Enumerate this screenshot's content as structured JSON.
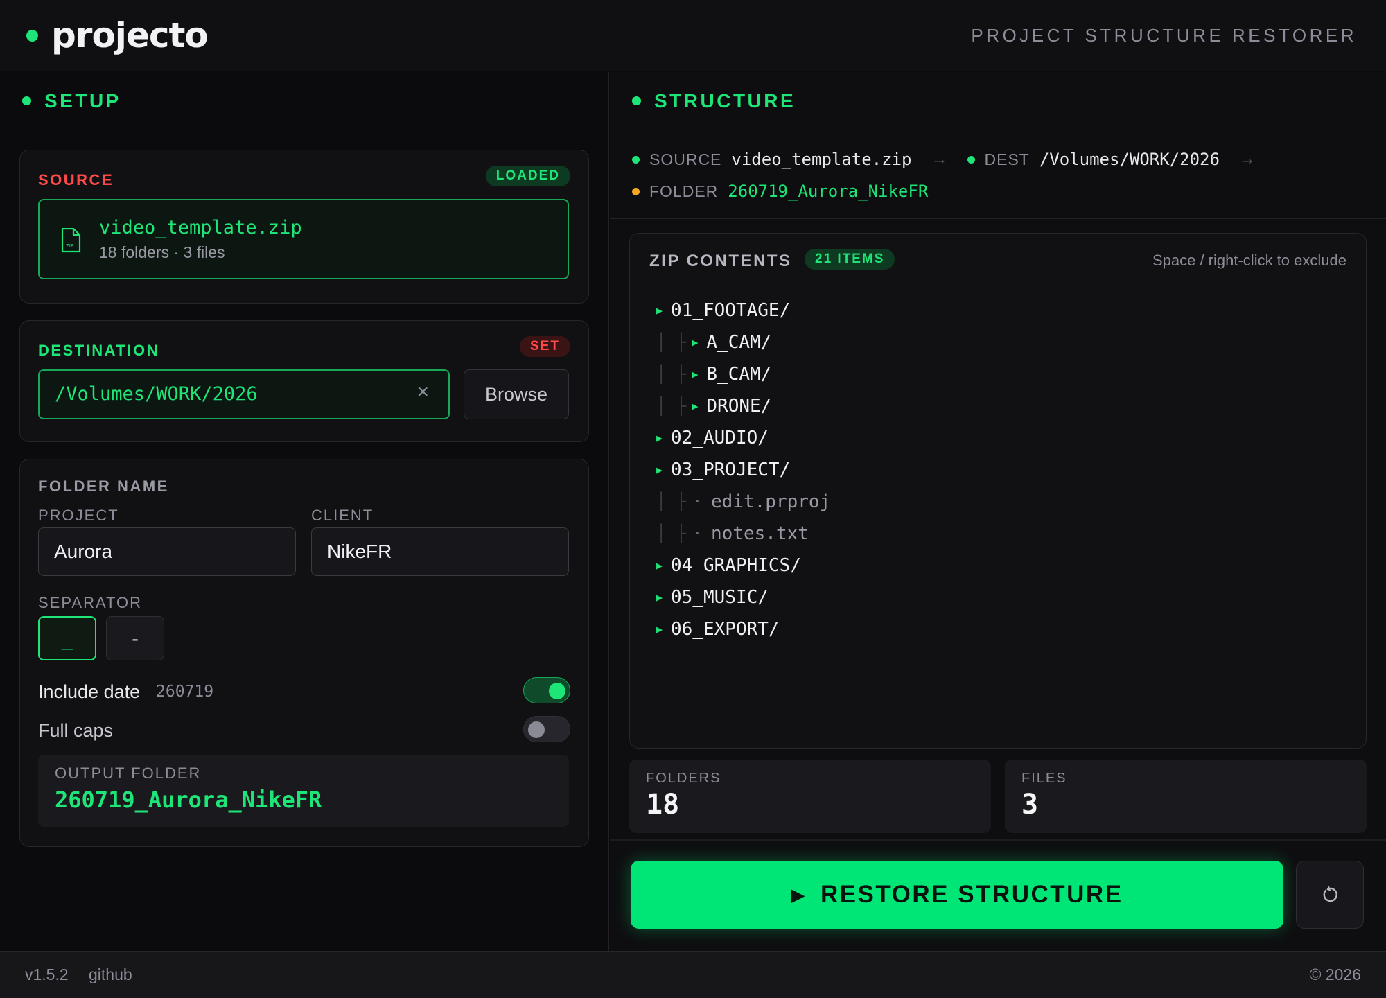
{
  "header": {
    "app_name": "projecto",
    "subtitle": "PROJECT STRUCTURE RESTORER"
  },
  "setup": {
    "title": "SETUP",
    "source": {
      "label": "SOURCE",
      "badge": "LOADED",
      "file_name": "video_template.zip",
      "meta": "18 folders · 3 files",
      "icon": "zip-file-icon"
    },
    "destination": {
      "label": "DESTINATION",
      "badge": "SET",
      "path": "/Volumes/WORK/2026",
      "clear_glyph": "×",
      "browse_label": "Browse"
    },
    "folder_name": {
      "label": "FOLDER NAME",
      "project_label": "PROJECT",
      "project_value": "Aurora",
      "client_label": "CLIENT",
      "client_value": "NikeFR",
      "separator_label": "SEPARATOR",
      "separators": [
        "_",
        "-"
      ],
      "selected_separator": "_",
      "include_date_label": "Include date",
      "include_date_value": "260719",
      "include_date_on": true,
      "full_caps_label": "Full caps",
      "full_caps_on": false,
      "output_label": "OUTPUT FOLDER",
      "output_value": "260719_Aurora_NikeFR"
    }
  },
  "structure": {
    "title": "STRUCTURE",
    "crumbs": {
      "source_key": "SOURCE",
      "source_val": "video_template.zip",
      "dest_key": "DEST",
      "dest_val": "/Volumes/WORK/2026",
      "arrow": "→",
      "folder_key": "FOLDER",
      "folder_val": "260719_Aurora_NikeFR"
    },
    "zip": {
      "title": "ZIP CONTENTS",
      "badge": "21 ITEMS",
      "hint": "Space / right-click to exclude",
      "tree": [
        {
          "name": "01_FOOTAGE/",
          "depth": 0,
          "type": "folder"
        },
        {
          "name": "A_CAM/",
          "depth": 1,
          "type": "folder"
        },
        {
          "name": "B_CAM/",
          "depth": 1,
          "type": "folder"
        },
        {
          "name": "DRONE/",
          "depth": 1,
          "type": "folder"
        },
        {
          "name": "02_AUDIO/",
          "depth": 0,
          "type": "folder"
        },
        {
          "name": "03_PROJECT/",
          "depth": 0,
          "type": "folder"
        },
        {
          "name": "edit.prproj",
          "depth": 1,
          "type": "file"
        },
        {
          "name": "notes.txt",
          "depth": 1,
          "type": "file"
        },
        {
          "name": "04_GRAPHICS/",
          "depth": 0,
          "type": "folder"
        },
        {
          "name": "05_MUSIC/",
          "depth": 0,
          "type": "folder"
        },
        {
          "name": "06_EXPORT/",
          "depth": 0,
          "type": "folder"
        }
      ]
    },
    "stats": {
      "folders_label": "FOLDERS",
      "folders_value": "18",
      "files_label": "FILES",
      "files_value": "3"
    },
    "restore_label": "RESTORE STRUCTURE",
    "restore_glyph": "▶",
    "reset_icon": "reset-icon"
  },
  "footer": {
    "version": "v1.5.2",
    "link": "github",
    "copyright": "© 2026"
  },
  "colors": {
    "accent": "#1ee577",
    "danger": "#ff4a4a",
    "warning": "#f5a623",
    "background": "#0b0b0d"
  }
}
